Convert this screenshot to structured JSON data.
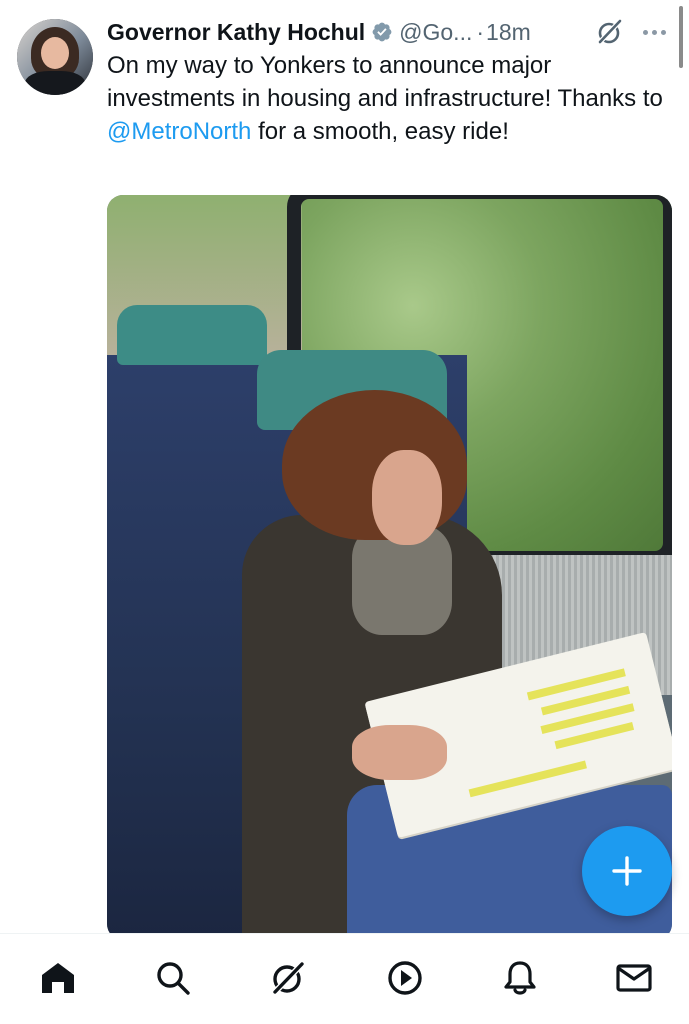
{
  "post": {
    "author_name": "Governor Kathy Hochul",
    "handle": "@Go...",
    "separator": "·",
    "time": "18m",
    "text_before": "On my way to Yonkers to announce major investments in housing and infrastructure! Thanks to ",
    "mention": "@MetroNorth",
    "text_after": " for a smooth, easy ride!",
    "avatar_icon": "profile-photo",
    "verified_icon": "verified-badge-icon",
    "grok_icon": "grok-icon",
    "more_icon": "more-options-icon",
    "media_alt": "photo"
  },
  "fab": {
    "icon": "compose-plus-icon"
  },
  "tabbar": {
    "items": [
      {
        "name": "home",
        "icon": "home-icon"
      },
      {
        "name": "search",
        "icon": "search-icon"
      },
      {
        "name": "grok",
        "icon": "grok-icon"
      },
      {
        "name": "video",
        "icon": "play-icon"
      },
      {
        "name": "notifications",
        "icon": "bell-icon"
      },
      {
        "name": "messages",
        "icon": "mail-icon"
      }
    ]
  },
  "colors": {
    "text": "#0f1419",
    "secondary": "#536471",
    "accent": "#1d9bf0",
    "verified": "#829aab"
  }
}
